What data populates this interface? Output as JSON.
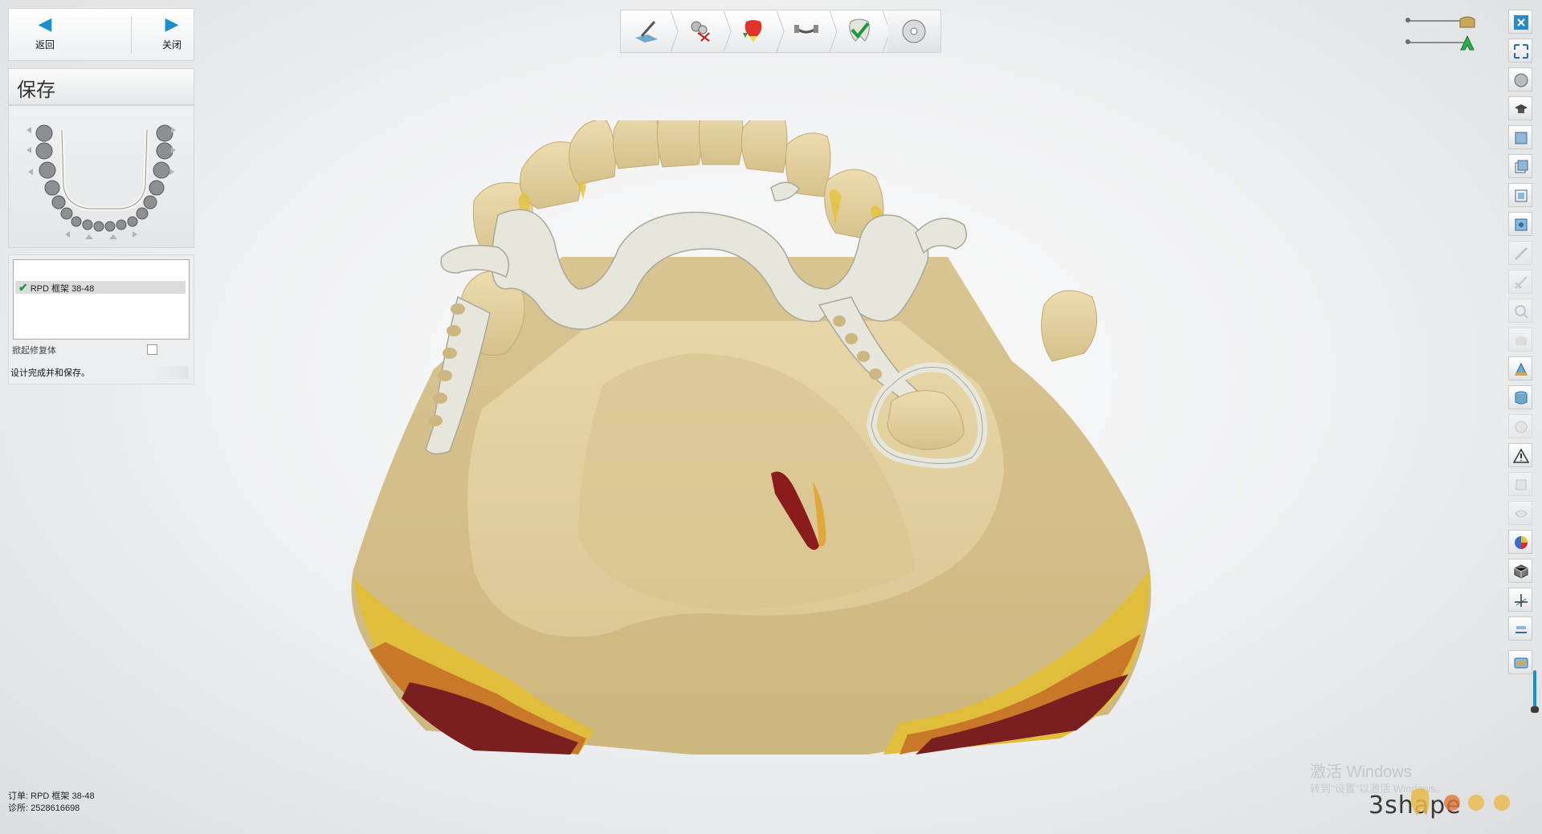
{
  "nav": {
    "back_label": "返回",
    "close_label": "关闭"
  },
  "panel": {
    "title": "保存",
    "list_item": "RPD 框架 38-48",
    "option_label": "掀起修复体",
    "status": "设计完成并和保存。"
  },
  "footer": {
    "order_label": "订单:",
    "order_value": "RPD 框架 38-48",
    "diag_label": "诊所:",
    "diag_value": "2528616698"
  },
  "watermark": {
    "line1": "激活 Windows",
    "line2": "转到\"设置\"以激活 Windows。"
  },
  "brand": "3shape",
  "toolbar_steps": [
    "survey-step",
    "cutout-step",
    "blockout-step",
    "framework-step",
    "verify-step",
    "save-step"
  ],
  "right_tools": [
    "close-icon",
    "fullscreen-icon",
    "view-icon",
    "cap-icon",
    "view-front-icon",
    "view-side-icon",
    "view-top-icon",
    "view-3d-icon",
    "tool-a-icon",
    "tool-b-icon",
    "tool-c-icon",
    "tool-d-icon",
    "model-icon",
    "cylinder-icon",
    "tool-e-icon",
    "warning-icon",
    "tool-f-icon",
    "tool-g-icon",
    "color-icon",
    "cube-icon",
    "axis-icon",
    "slider-icon",
    "scanner-icon"
  ],
  "colors": {
    "accent": "#1c8fc9",
    "model": "#e1cd9e",
    "framework": "#e4e4da",
    "undercut_red": "#7a1f1f"
  }
}
